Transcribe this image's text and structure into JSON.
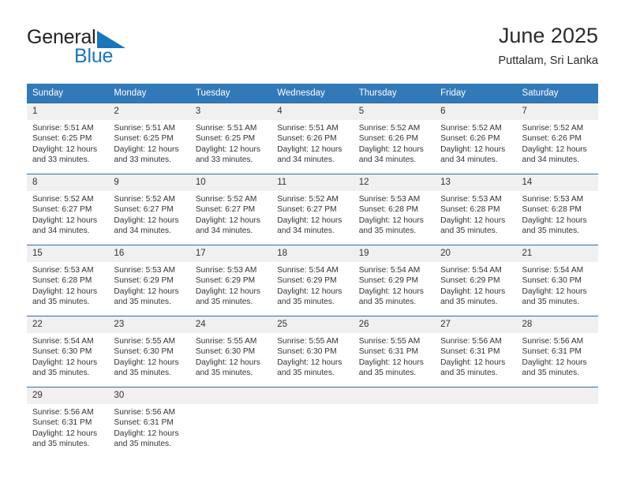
{
  "brand": {
    "name_part1": "General",
    "name_part2": "Blue",
    "color_dark": "#231f20",
    "color_blue": "#1b75bb"
  },
  "header": {
    "title": "June 2025",
    "subtitle": "Puttalam, Sri Lanka"
  },
  "theme": {
    "header_bg": "#3279b9",
    "row_divider": "#2e6da4",
    "daynum_bg": "#f0f0f0"
  },
  "columns": [
    "Sunday",
    "Monday",
    "Tuesday",
    "Wednesday",
    "Thursday",
    "Friday",
    "Saturday"
  ],
  "weeks": [
    [
      {
        "day": "1",
        "sunrise": "Sunrise: 5:51 AM",
        "sunset": "Sunset: 6:25 PM",
        "daylight": "Daylight: 12 hours and 33 minutes."
      },
      {
        "day": "2",
        "sunrise": "Sunrise: 5:51 AM",
        "sunset": "Sunset: 6:25 PM",
        "daylight": "Daylight: 12 hours and 33 minutes."
      },
      {
        "day": "3",
        "sunrise": "Sunrise: 5:51 AM",
        "sunset": "Sunset: 6:25 PM",
        "daylight": "Daylight: 12 hours and 33 minutes."
      },
      {
        "day": "4",
        "sunrise": "Sunrise: 5:51 AM",
        "sunset": "Sunset: 6:26 PM",
        "daylight": "Daylight: 12 hours and 34 minutes."
      },
      {
        "day": "5",
        "sunrise": "Sunrise: 5:52 AM",
        "sunset": "Sunset: 6:26 PM",
        "daylight": "Daylight: 12 hours and 34 minutes."
      },
      {
        "day": "6",
        "sunrise": "Sunrise: 5:52 AM",
        "sunset": "Sunset: 6:26 PM",
        "daylight": "Daylight: 12 hours and 34 minutes."
      },
      {
        "day": "7",
        "sunrise": "Sunrise: 5:52 AM",
        "sunset": "Sunset: 6:26 PM",
        "daylight": "Daylight: 12 hours and 34 minutes."
      }
    ],
    [
      {
        "day": "8",
        "sunrise": "Sunrise: 5:52 AM",
        "sunset": "Sunset: 6:27 PM",
        "daylight": "Daylight: 12 hours and 34 minutes."
      },
      {
        "day": "9",
        "sunrise": "Sunrise: 5:52 AM",
        "sunset": "Sunset: 6:27 PM",
        "daylight": "Daylight: 12 hours and 34 minutes."
      },
      {
        "day": "10",
        "sunrise": "Sunrise: 5:52 AM",
        "sunset": "Sunset: 6:27 PM",
        "daylight": "Daylight: 12 hours and 34 minutes."
      },
      {
        "day": "11",
        "sunrise": "Sunrise: 5:52 AM",
        "sunset": "Sunset: 6:27 PM",
        "daylight": "Daylight: 12 hours and 34 minutes."
      },
      {
        "day": "12",
        "sunrise": "Sunrise: 5:53 AM",
        "sunset": "Sunset: 6:28 PM",
        "daylight": "Daylight: 12 hours and 35 minutes."
      },
      {
        "day": "13",
        "sunrise": "Sunrise: 5:53 AM",
        "sunset": "Sunset: 6:28 PM",
        "daylight": "Daylight: 12 hours and 35 minutes."
      },
      {
        "day": "14",
        "sunrise": "Sunrise: 5:53 AM",
        "sunset": "Sunset: 6:28 PM",
        "daylight": "Daylight: 12 hours and 35 minutes."
      }
    ],
    [
      {
        "day": "15",
        "sunrise": "Sunrise: 5:53 AM",
        "sunset": "Sunset: 6:28 PM",
        "daylight": "Daylight: 12 hours and 35 minutes."
      },
      {
        "day": "16",
        "sunrise": "Sunrise: 5:53 AM",
        "sunset": "Sunset: 6:29 PM",
        "daylight": "Daylight: 12 hours and 35 minutes."
      },
      {
        "day": "17",
        "sunrise": "Sunrise: 5:53 AM",
        "sunset": "Sunset: 6:29 PM",
        "daylight": "Daylight: 12 hours and 35 minutes."
      },
      {
        "day": "18",
        "sunrise": "Sunrise: 5:54 AM",
        "sunset": "Sunset: 6:29 PM",
        "daylight": "Daylight: 12 hours and 35 minutes."
      },
      {
        "day": "19",
        "sunrise": "Sunrise: 5:54 AM",
        "sunset": "Sunset: 6:29 PM",
        "daylight": "Daylight: 12 hours and 35 minutes."
      },
      {
        "day": "20",
        "sunrise": "Sunrise: 5:54 AM",
        "sunset": "Sunset: 6:29 PM",
        "daylight": "Daylight: 12 hours and 35 minutes."
      },
      {
        "day": "21",
        "sunrise": "Sunrise: 5:54 AM",
        "sunset": "Sunset: 6:30 PM",
        "daylight": "Daylight: 12 hours and 35 minutes."
      }
    ],
    [
      {
        "day": "22",
        "sunrise": "Sunrise: 5:54 AM",
        "sunset": "Sunset: 6:30 PM",
        "daylight": "Daylight: 12 hours and 35 minutes."
      },
      {
        "day": "23",
        "sunrise": "Sunrise: 5:55 AM",
        "sunset": "Sunset: 6:30 PM",
        "daylight": "Daylight: 12 hours and 35 minutes."
      },
      {
        "day": "24",
        "sunrise": "Sunrise: 5:55 AM",
        "sunset": "Sunset: 6:30 PM",
        "daylight": "Daylight: 12 hours and 35 minutes."
      },
      {
        "day": "25",
        "sunrise": "Sunrise: 5:55 AM",
        "sunset": "Sunset: 6:30 PM",
        "daylight": "Daylight: 12 hours and 35 minutes."
      },
      {
        "day": "26",
        "sunrise": "Sunrise: 5:55 AM",
        "sunset": "Sunset: 6:31 PM",
        "daylight": "Daylight: 12 hours and 35 minutes."
      },
      {
        "day": "27",
        "sunrise": "Sunrise: 5:56 AM",
        "sunset": "Sunset: 6:31 PM",
        "daylight": "Daylight: 12 hours and 35 minutes."
      },
      {
        "day": "28",
        "sunrise": "Sunrise: 5:56 AM",
        "sunset": "Sunset: 6:31 PM",
        "daylight": "Daylight: 12 hours and 35 minutes."
      }
    ],
    [
      {
        "day": "29",
        "sunrise": "Sunrise: 5:56 AM",
        "sunset": "Sunset: 6:31 PM",
        "daylight": "Daylight: 12 hours and 35 minutes."
      },
      {
        "day": "30",
        "sunrise": "Sunrise: 5:56 AM",
        "sunset": "Sunset: 6:31 PM",
        "daylight": "Daylight: 12 hours and 35 minutes."
      },
      {
        "day": "",
        "sunrise": "",
        "sunset": "",
        "daylight": ""
      },
      {
        "day": "",
        "sunrise": "",
        "sunset": "",
        "daylight": ""
      },
      {
        "day": "",
        "sunrise": "",
        "sunset": "",
        "daylight": ""
      },
      {
        "day": "",
        "sunrise": "",
        "sunset": "",
        "daylight": ""
      },
      {
        "day": "",
        "sunrise": "",
        "sunset": "",
        "daylight": ""
      }
    ]
  ]
}
